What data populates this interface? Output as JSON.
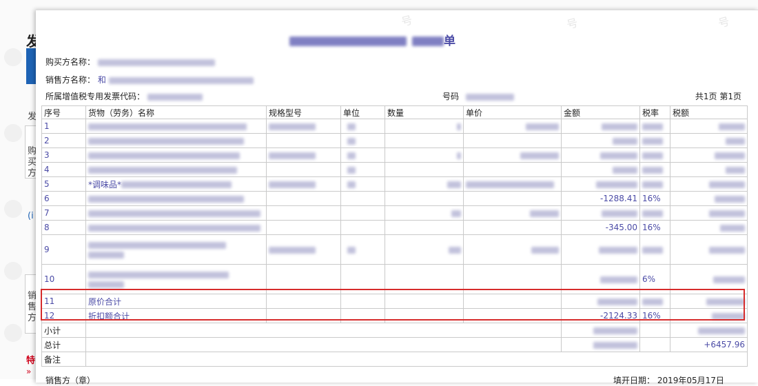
{
  "background": {
    "title": "发",
    "labels": [
      "发",
      "购",
      "买",
      "方",
      "(i",
      "销",
      "售",
      "方"
    ],
    "special": "特",
    "chevron": "»",
    "watermark": "号"
  },
  "doc": {
    "title_suffix": "单",
    "buyer_label": "购买方名称：",
    "seller_label": "销售方名称：",
    "seller_value_prefix": "和",
    "invoice_code_label": "所属增值税专用发票代码：",
    "number_label": "号码",
    "page_info": "共1页 第1页",
    "seller_footer": "销售方（章）",
    "issue_date_label": "填开日期：",
    "issue_date_value": "2019年05月17日"
  },
  "table": {
    "headers": [
      "序号",
      "货物（劳务）名称",
      "规格型号",
      "单位",
      "数量",
      "单价",
      "金额",
      "税率",
      "税额"
    ],
    "rows": [
      {
        "no": "1",
        "name": "",
        "amount": "",
        "rate": "",
        "tax": ""
      },
      {
        "no": "2",
        "name": "",
        "amount": "",
        "rate": "",
        "tax": ""
      },
      {
        "no": "3",
        "name": "",
        "amount": "",
        "rate": "",
        "tax": ""
      },
      {
        "no": "4",
        "name": "",
        "amount": "",
        "rate": "",
        "tax": ""
      },
      {
        "no": "5",
        "name": "*调味品*",
        "amount": "",
        "rate": "",
        "tax": ""
      },
      {
        "no": "6",
        "name": "",
        "amount": "-1288.41",
        "rate": "16%",
        "tax": ""
      },
      {
        "no": "7",
        "name": "",
        "amount": "",
        "rate": "",
        "tax": ""
      },
      {
        "no": "8",
        "name": "",
        "amount": "-345.00",
        "rate": "16%",
        "tax": ""
      },
      {
        "no": "9",
        "name": "",
        "amount": "",
        "rate": "",
        "tax": ""
      },
      {
        "no": "10",
        "name": "",
        "amount": "",
        "rate": "6%",
        "tax": ""
      },
      {
        "no": "11",
        "name": "原价合计",
        "amount": "",
        "rate": "",
        "tax": ""
      },
      {
        "no": "12",
        "name": "折扣额合计",
        "amount": "-2124.33",
        "rate": "16%",
        "tax": ""
      }
    ],
    "subtotal_label": "小计",
    "total_label": "总计",
    "total_tax": "+6457.96",
    "remark_label": "备注"
  }
}
